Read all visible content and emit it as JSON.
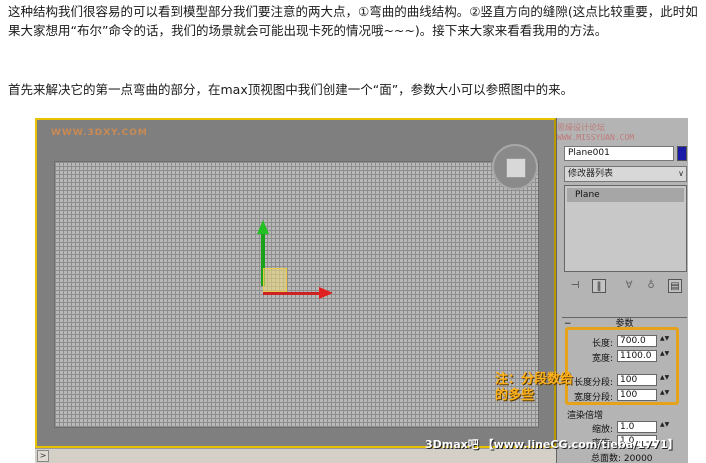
{
  "article": {
    "paragraph1": "这种结构我们很容易的可以看到模型部分我们要注意的两大点，①弯曲的曲线结构。②竖直方向的缝隙(这点比较重要，此时如果大家想用“布尔”命令的话，我们的场景就会可能出现卡死的情况哦~~~)。接下来大家来看看我用的方法。",
    "paragraph2": "首先来解决它的第一点弯曲的部分，在max顶视图中我们创建一个“面”，参数大小可以参照图中的来。"
  },
  "viewport": {
    "watermark": "WWW.3DXY.COM",
    "viewcube_icon": "viewcube-icon"
  },
  "panel": {
    "watermark": "思缘设计论坛 WWW.MISSYUAN.COM",
    "object_name": "Plane001",
    "object_color": "#1a1aa8",
    "modifier_list": "修改器列表",
    "modifier_list_arrow": "∨",
    "stack_item": "Plane",
    "tools": {
      "pin": "⊣",
      "show_end": "‖",
      "make_unique": "∀",
      "remove": "♁",
      "configure": "▤"
    },
    "params_minus": "−",
    "params_title": "参数",
    "length_label": "长度:",
    "length_value": "700.0",
    "width_label": "宽度:",
    "width_value": "1100.0",
    "length_segs_label": "长度分段:",
    "length_segs_value": "100",
    "width_segs_label": "宽度分段:",
    "width_segs_value": "100",
    "render_multipliers": "渲染倍增",
    "scale_label": "缩放:",
    "scale_value": "1.0",
    "density_label": "密度:",
    "density_value": "1.0",
    "total_faces": "总面数: 20000",
    "spin_glyph": "▲▼"
  },
  "note": "注：分段数给的多些",
  "site_banner": "3Dmax吧 【www.lineCG.com/tieba/1771】",
  "scrollbar": {
    "left_arrow": ">"
  }
}
